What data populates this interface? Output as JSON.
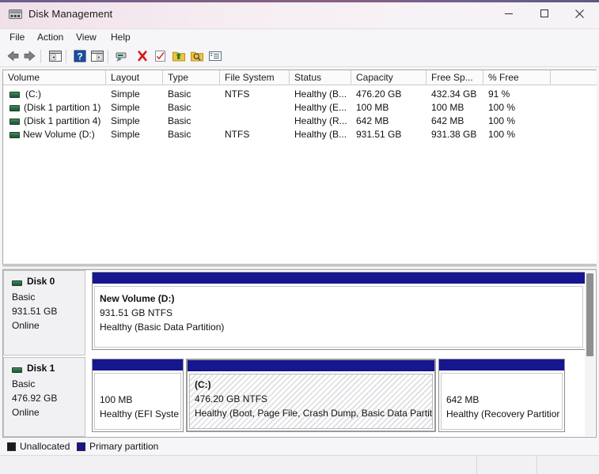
{
  "window": {
    "title": "Disk Management",
    "icon": "disk-management-icon",
    "controls": {
      "minimize": "minimize-icon",
      "maximize": "maximize-icon",
      "close": "close-icon"
    }
  },
  "menu": {
    "items": [
      {
        "label": "File"
      },
      {
        "label": "Action"
      },
      {
        "label": "View"
      },
      {
        "label": "Help"
      }
    ]
  },
  "toolbar": {
    "buttons": [
      {
        "name": "back-icon"
      },
      {
        "name": "forward-icon"
      },
      {
        "name": "show-hide-console-tree-icon"
      },
      {
        "name": "help-icon"
      },
      {
        "name": "show-hide-action-pane-icon"
      },
      {
        "name": "properties-icon"
      },
      {
        "name": "delete-icon"
      },
      {
        "name": "rescan-disks-icon"
      },
      {
        "name": "mount-volume-icon"
      },
      {
        "name": "explore-volume-icon"
      },
      {
        "name": "all-tasks-icon"
      }
    ]
  },
  "volume_table": {
    "columns": [
      {
        "label": "Volume"
      },
      {
        "label": "Layout"
      },
      {
        "label": "Type"
      },
      {
        "label": "File System"
      },
      {
        "label": "Status"
      },
      {
        "label": "Capacity"
      },
      {
        "label": "Free Sp..."
      },
      {
        "label": "% Free"
      },
      {
        "label": ""
      }
    ],
    "rows": [
      {
        "volume": "(C:)",
        "layout": "Simple",
        "type": "Basic",
        "file_system": "NTFS",
        "status": "Healthy (B...",
        "capacity": "476.20 GB",
        "free_space": "432.34 GB",
        "percent_free": "91 %"
      },
      {
        "volume": "(Disk 1 partition 1)",
        "layout": "Simple",
        "type": "Basic",
        "file_system": "",
        "status": "Healthy (E...",
        "capacity": "100 MB",
        "free_space": "100 MB",
        "percent_free": "100 %"
      },
      {
        "volume": "(Disk 1 partition 4)",
        "layout": "Simple",
        "type": "Basic",
        "file_system": "",
        "status": "Healthy (R...",
        "capacity": "642 MB",
        "free_space": "642 MB",
        "percent_free": "100 %"
      },
      {
        "volume": "New Volume (D:)",
        "layout": "Simple",
        "type": "Basic",
        "file_system": "NTFS",
        "status": "Healthy (B...",
        "capacity": "931.51 GB",
        "free_space": "931.38 GB",
        "percent_free": "100 %"
      }
    ]
  },
  "disks": [
    {
      "name": "Disk 0",
      "type": "Basic",
      "size": "931.51 GB",
      "state": "Online",
      "partitions": [
        {
          "title": "New Volume  (D:)",
          "size_fs": "931.51 GB NTFS",
          "status": "Healthy (Basic Data Partition)",
          "selected": false
        }
      ]
    },
    {
      "name": "Disk 1",
      "type": "Basic",
      "size": "476.92 GB",
      "state": "Online",
      "partitions": [
        {
          "title": "",
          "size_fs": "100 MB",
          "status": "Healthy (EFI Syste",
          "selected": false
        },
        {
          "title": "(C:)",
          "size_fs": "476.20 GB NTFS",
          "status": "Healthy (Boot, Page File, Crash Dump, Basic Data Partitio",
          "selected": true
        },
        {
          "title": "",
          "size_fs": "642 MB",
          "status": "Healthy (Recovery Partitior",
          "selected": false
        }
      ]
    }
  ],
  "legend": [
    {
      "label": "Unallocated",
      "color": "#1a1a1a"
    },
    {
      "label": "Primary partition",
      "color": "#16168f"
    }
  ],
  "colors": {
    "partition_cap": "#16168f",
    "unallocated": "#1a1a1a",
    "title_accent": "#6c5f8d"
  }
}
